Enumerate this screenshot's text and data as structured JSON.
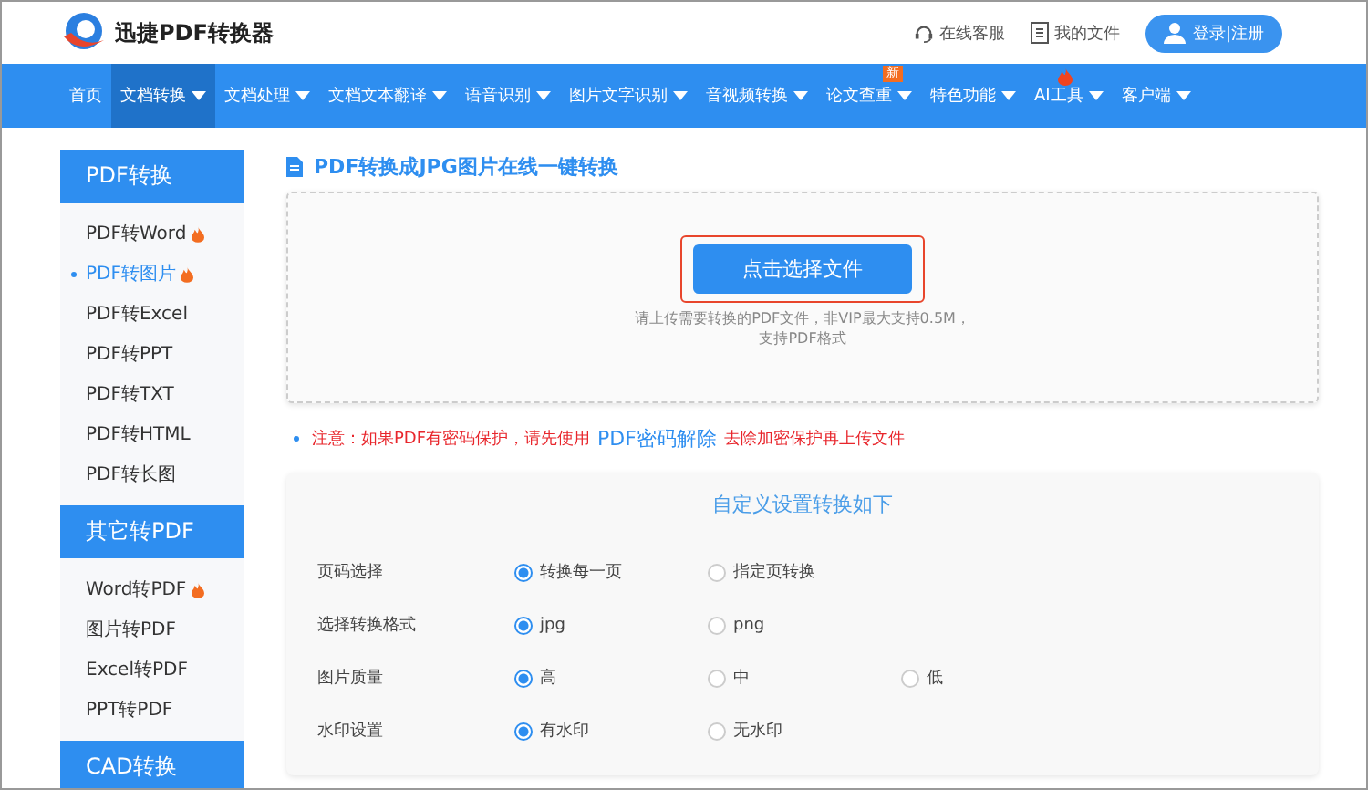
{
  "header": {
    "brand": "迅捷PDF转换器",
    "links": [
      "在线客服",
      "我的文件"
    ],
    "login": "登录|注册"
  },
  "nav": [
    {
      "label": "首页",
      "selected": false,
      "dropdown": false
    },
    {
      "label": "文档转换",
      "selected": true,
      "dropdown": true
    },
    {
      "label": "文档处理",
      "selected": false,
      "dropdown": true
    },
    {
      "label": "文档文本翻译",
      "selected": false,
      "dropdown": true
    },
    {
      "label": "语音识别",
      "selected": false,
      "dropdown": true
    },
    {
      "label": "图片文字识别",
      "selected": false,
      "dropdown": true
    },
    {
      "label": "音视频转换",
      "selected": false,
      "dropdown": true
    },
    {
      "label": "论文查重",
      "selected": false,
      "dropdown": true,
      "badge": "新"
    },
    {
      "label": "特色功能",
      "selected": false,
      "dropdown": true
    },
    {
      "label": "AI工具",
      "selected": false,
      "dropdown": true,
      "hot": true
    },
    {
      "label": "客户端",
      "selected": false,
      "dropdown": true
    }
  ],
  "sidebar": [
    {
      "title": "PDF转换",
      "items": [
        {
          "label": "PDF转Word",
          "hot": true,
          "selected": false
        },
        {
          "label": "PDF转图片",
          "hot": true,
          "selected": true
        },
        {
          "label": "PDF转Excel",
          "hot": false,
          "selected": false
        },
        {
          "label": "PDF转PPT",
          "hot": false,
          "selected": false
        },
        {
          "label": "PDF转TXT",
          "hot": false,
          "selected": false
        },
        {
          "label": "PDF转HTML",
          "hot": false,
          "selected": false
        },
        {
          "label": "PDF转长图",
          "hot": false,
          "selected": false
        }
      ]
    },
    {
      "title": "其它转PDF",
      "items": [
        {
          "label": "Word转PDF",
          "hot": true,
          "selected": false
        },
        {
          "label": "图片转PDF",
          "hot": false,
          "selected": false
        },
        {
          "label": "Excel转PDF",
          "hot": false,
          "selected": false
        },
        {
          "label": "PPT转PDF",
          "hot": false,
          "selected": false
        }
      ]
    },
    {
      "title": "CAD转换"
    }
  ],
  "page_title": "PDF转换成JPG图片在线一键转换",
  "upload": {
    "button": "点击选择文件",
    "hint": [
      "请上传需要转换的PDF文件，非VIP最大支持0.5M，",
      "支持PDF格式"
    ]
  },
  "notice": {
    "text": "注意：如果PDF有密码保护，请先使用",
    "link": "PDF密码解除",
    "after": "去除加密保护再上传文件"
  },
  "settings": {
    "title": "自定义设置转换如下",
    "rows": [
      {
        "label": "页码选择",
        "options": [
          {
            "label": "转换每一页",
            "selected": true
          },
          {
            "label": "指定页转换",
            "selected": false
          }
        ]
      },
      {
        "label": "选择转换格式",
        "options": [
          {
            "label": "jpg",
            "selected": true
          },
          {
            "label": "png",
            "selected": false
          }
        ]
      },
      {
        "label": "图片质量",
        "options": [
          {
            "label": "高",
            "selected": true
          },
          {
            "label": "中",
            "selected": false
          },
          {
            "label": "低",
            "selected": false
          }
        ]
      },
      {
        "label": "水印设置",
        "options": [
          {
            "label": "有水印",
            "selected": true
          },
          {
            "label": "无水印",
            "selected": false
          }
        ]
      }
    ]
  }
}
